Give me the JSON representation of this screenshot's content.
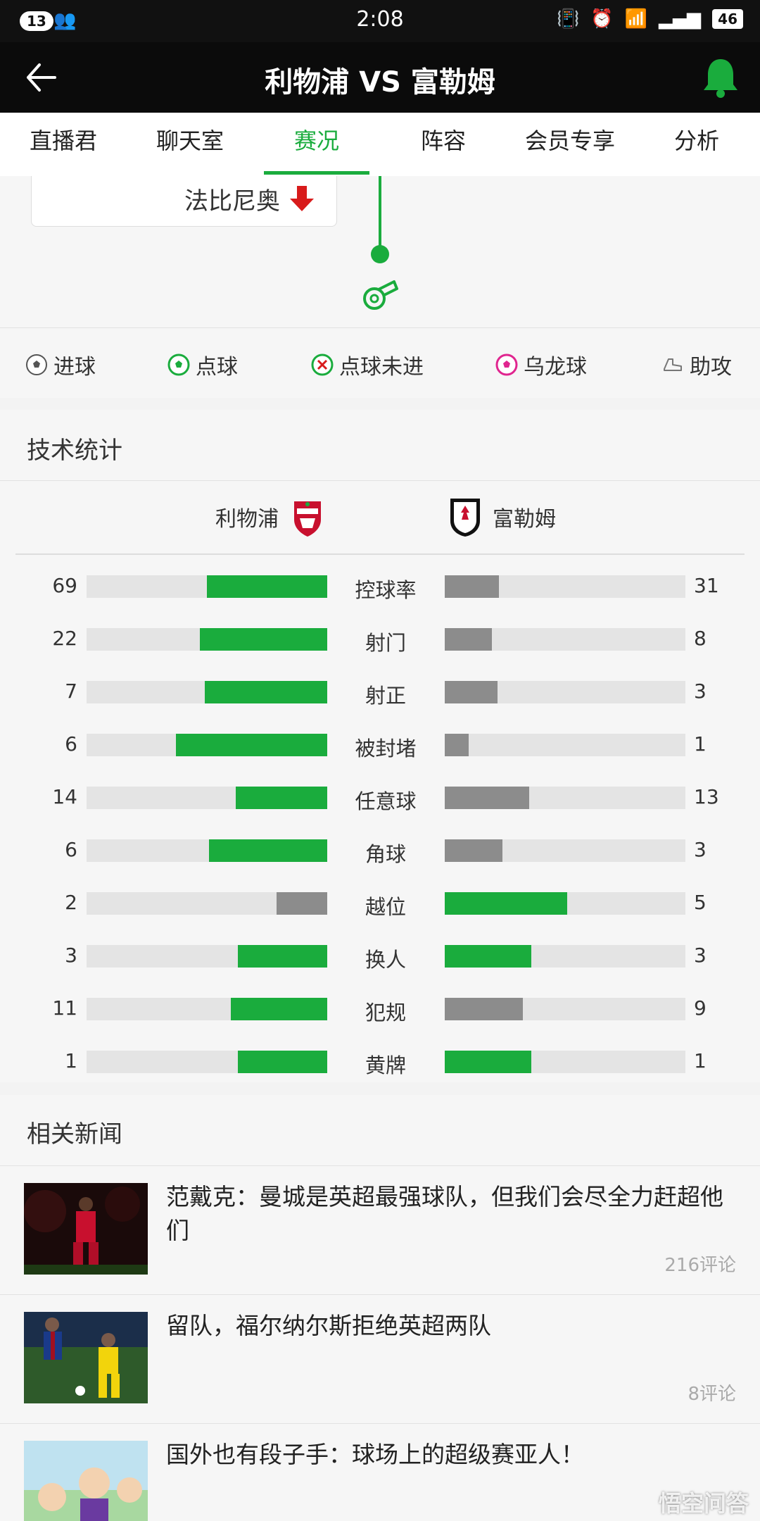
{
  "status_bar": {
    "notification_count": "13",
    "time": "2:08",
    "battery": "46"
  },
  "header": {
    "title": "利物浦 VS 富勒姆"
  },
  "tabs": [
    {
      "label": "直播君"
    },
    {
      "label": "聊天室"
    },
    {
      "label": "赛况",
      "active": true
    },
    {
      "label": "阵容"
    },
    {
      "label": "会员专享"
    },
    {
      "label": "分析"
    }
  ],
  "event": {
    "player": "法比尼奥"
  },
  "legend": [
    {
      "label": "进球",
      "icon": "ball-icon"
    },
    {
      "label": "点球",
      "icon": "penalty-icon"
    },
    {
      "label": "点球未进",
      "icon": "penalty-missed-icon"
    },
    {
      "label": "乌龙球",
      "icon": "own-goal-icon"
    },
    {
      "label": "助攻",
      "icon": "boot-icon"
    }
  ],
  "stats": {
    "title": "技术统计",
    "home_team": "利物浦",
    "away_team": "富勒姆",
    "rows": [
      {
        "label": "控球率",
        "home": "69",
        "away": "31",
        "home_fill": 0.5,
        "away_fill": 0.225,
        "home_color": "green",
        "away_color": "gray"
      },
      {
        "label": "射门",
        "home": "22",
        "away": "8",
        "home_fill": 0.53,
        "away_fill": 0.195,
        "home_color": "green",
        "away_color": "gray"
      },
      {
        "label": "射正",
        "home": "7",
        "away": "3",
        "home_fill": 0.51,
        "away_fill": 0.22,
        "home_color": "green",
        "away_color": "gray"
      },
      {
        "label": "被封堵",
        "home": "6",
        "away": "1",
        "home_fill": 0.63,
        "away_fill": 0.1,
        "home_color": "green",
        "away_color": "gray"
      },
      {
        "label": "任意球",
        "home": "14",
        "away": "13",
        "home_fill": 0.38,
        "away_fill": 0.35,
        "home_color": "green",
        "away_color": "gray"
      },
      {
        "label": "角球",
        "home": "6",
        "away": "3",
        "home_fill": 0.49,
        "away_fill": 0.24,
        "home_color": "green",
        "away_color": "gray"
      },
      {
        "label": "越位",
        "home": "2",
        "away": "5",
        "home_fill": 0.21,
        "away_fill": 0.51,
        "home_color": "gray",
        "away_color": "green"
      },
      {
        "label": "换人",
        "home": "3",
        "away": "3",
        "home_fill": 0.37,
        "away_fill": 0.36,
        "home_color": "green",
        "away_color": "green"
      },
      {
        "label": "犯规",
        "home": "11",
        "away": "9",
        "home_fill": 0.4,
        "away_fill": 0.325,
        "home_color": "green",
        "away_color": "gray"
      },
      {
        "label": "黄牌",
        "home": "1",
        "away": "1",
        "home_fill": 0.37,
        "away_fill": 0.36,
        "home_color": "green",
        "away_color": "green"
      }
    ]
  },
  "news": {
    "title": "相关新闻",
    "items": [
      {
        "headline": "范戴克：曼城是英超最强球队，但我们会尽全力赶超他们",
        "comments": "216评论"
      },
      {
        "headline": "留队，福尔纳尔斯拒绝英超两队",
        "comments": "8评论"
      },
      {
        "headline": "国外也有段子手：球场上的超级赛亚人！",
        "comments": ""
      }
    ]
  },
  "watermark": "悟空问答",
  "colors": {
    "accent": "#1aac3d",
    "gray_bar": "#8c8c8c",
    "track": "#e4e4e4"
  }
}
